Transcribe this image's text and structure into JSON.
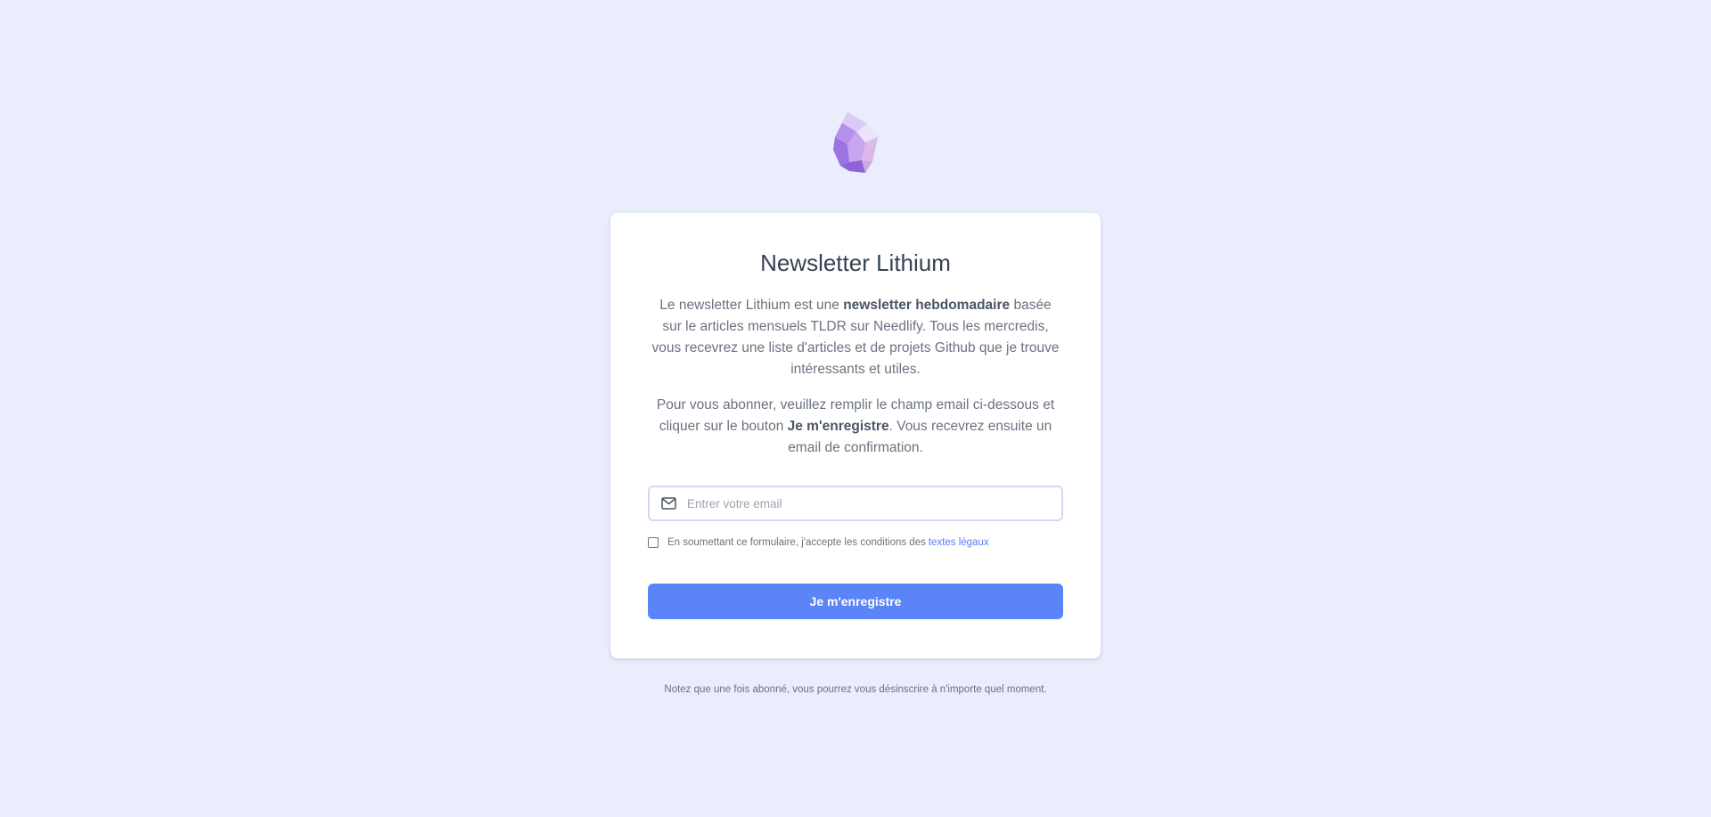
{
  "header": {
    "logo_icon": "lithium-crystal-icon"
  },
  "card": {
    "title": "Newsletter Lithium",
    "intro": {
      "before": "Le newsletter Lithium est une ",
      "bold": "newsletter hebdomadaire",
      "after": " basée sur le articles mensuels TLDR sur Needlify. Tous les mercredis, vous recevrez une liste d'articles et de projets Github que je trouve intéressants et utiles."
    },
    "instructions": {
      "before": "Pour vous abonner, veuillez remplir le champ email ci-dessous et cliquer sur le bouton ",
      "bold": "Je m'enregistre",
      "after": ". Vous recevrez ensuite un email de confirmation."
    }
  },
  "form": {
    "email_icon": "mail-icon",
    "email_placeholder": "Entrer votre email",
    "email_value": "",
    "consent_text": "En soumettant ce formulaire, j'accepte les conditions des",
    "consent_link": "textes légaux",
    "consent_checked": false,
    "submit_label": "Je m'enregistre"
  },
  "footer": {
    "note": "Notez que une fois abonné, vous pourrez vous désinscrire à n'importe quel moment."
  },
  "colors": {
    "background": "#e9edfc",
    "card": "#ffffff",
    "accent": "#5b84f8",
    "link": "#5b7df5",
    "title": "#374151",
    "text": "#6b7280"
  }
}
